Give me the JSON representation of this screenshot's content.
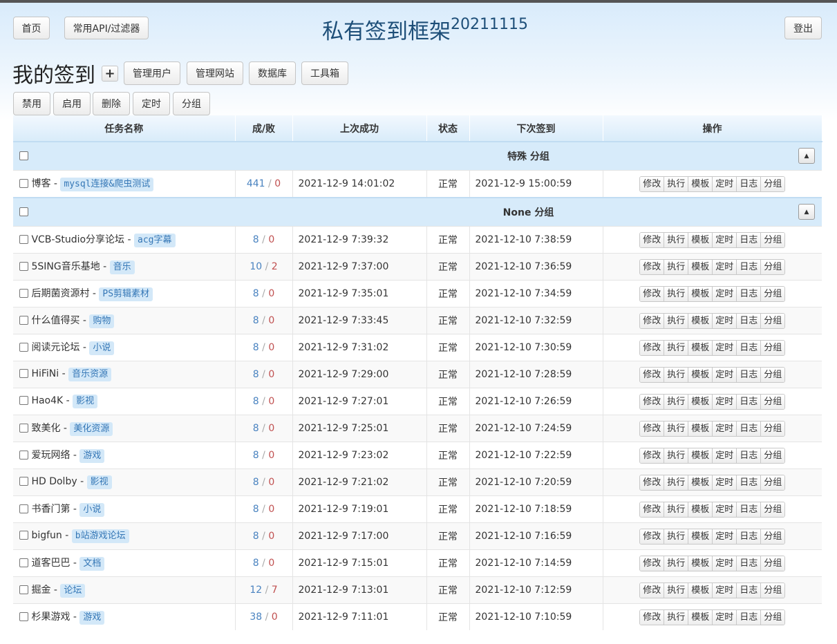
{
  "nav": {
    "home": "首页",
    "api_filter": "常用API/过滤器",
    "logout": "登出"
  },
  "app_title": "私有签到框架",
  "app_version": "20211115",
  "page_heading": "我的签到",
  "add_icon": "plus-icon",
  "toolbar_top": [
    "管理用户",
    "管理网站",
    "数据库",
    "工具箱"
  ],
  "toolbar_actions": [
    "禁用",
    "启用",
    "删除",
    "定时",
    "分组"
  ],
  "columns": [
    "任务名称",
    "成/败",
    "上次成功",
    "状态",
    "下次签到",
    "操作"
  ],
  "row_actions": [
    "修改",
    "执行",
    "模板",
    "定时",
    "日志",
    "分组"
  ],
  "groups": [
    {
      "title": "特殊 分组",
      "rows": [
        {
          "name": "博客",
          "tag": "mysql连接&爬虫测试",
          "success": "441",
          "fail": "0",
          "last": "2021-12-9 14:01:02",
          "status": "正常",
          "next": "2021-12-9 15:00:59"
        }
      ]
    },
    {
      "title": "None 分组",
      "rows": [
        {
          "name": "VCB-Studio分享论坛",
          "tag": "acg字幕",
          "success": "8",
          "fail": "0",
          "last": "2021-12-9 7:39:32",
          "status": "正常",
          "next": "2021-12-10 7:38:59"
        },
        {
          "name": "5SING音乐基地",
          "tag": "音乐",
          "success": "10",
          "fail": "2",
          "last": "2021-12-9 7:37:00",
          "status": "正常",
          "next": "2021-12-10 7:36:59"
        },
        {
          "name": "后期菌资源村",
          "tag": "PS剪辑素材",
          "success": "8",
          "fail": "0",
          "last": "2021-12-9 7:35:01",
          "status": "正常",
          "next": "2021-12-10 7:34:59"
        },
        {
          "name": "什么值得买",
          "tag": "购物",
          "success": "8",
          "fail": "0",
          "last": "2021-12-9 7:33:45",
          "status": "正常",
          "next": "2021-12-10 7:32:59"
        },
        {
          "name": "阅读元论坛",
          "tag": "小说",
          "success": "8",
          "fail": "0",
          "last": "2021-12-9 7:31:02",
          "status": "正常",
          "next": "2021-12-10 7:30:59"
        },
        {
          "name": "HiFiNi",
          "tag": "音乐资源",
          "success": "8",
          "fail": "0",
          "last": "2021-12-9 7:29:00",
          "status": "正常",
          "next": "2021-12-10 7:28:59"
        },
        {
          "name": "Hao4K",
          "tag": "影视",
          "success": "8",
          "fail": "0",
          "last": "2021-12-9 7:27:01",
          "status": "正常",
          "next": "2021-12-10 7:26:59"
        },
        {
          "name": "致美化",
          "tag": "美化资源",
          "success": "8",
          "fail": "0",
          "last": "2021-12-9 7:25:01",
          "status": "正常",
          "next": "2021-12-10 7:24:59"
        },
        {
          "name": "爱玩网络",
          "tag": "游戏",
          "success": "8",
          "fail": "0",
          "last": "2021-12-9 7:23:02",
          "status": "正常",
          "next": "2021-12-10 7:22:59"
        },
        {
          "name": "HD Dolby",
          "tag": "影视",
          "success": "8",
          "fail": "0",
          "last": "2021-12-9 7:21:02",
          "status": "正常",
          "next": "2021-12-10 7:20:59"
        },
        {
          "name": "书香门第",
          "tag": "小说",
          "success": "8",
          "fail": "0",
          "last": "2021-12-9 7:19:01",
          "status": "正常",
          "next": "2021-12-10 7:18:59"
        },
        {
          "name": "bigfun",
          "tag": "b站游戏论坛",
          "success": "8",
          "fail": "0",
          "last": "2021-12-9 7:17:00",
          "status": "正常",
          "next": "2021-12-10 7:16:59"
        },
        {
          "name": "道客巴巴",
          "tag": "文档",
          "success": "8",
          "fail": "0",
          "last": "2021-12-9 7:15:01",
          "status": "正常",
          "next": "2021-12-10 7:14:59"
        },
        {
          "name": "掘金",
          "tag": "论坛",
          "success": "12",
          "fail": "7",
          "last": "2021-12-9 7:13:01",
          "status": "正常",
          "next": "2021-12-10 7:12:59"
        },
        {
          "name": "杉果游戏",
          "tag": "游戏",
          "success": "38",
          "fail": "0",
          "last": "2021-12-9 7:11:01",
          "status": "正常",
          "next": "2021-12-10 7:10:59"
        }
      ]
    }
  ],
  "colors": {
    "accent_text": "#1d4e78",
    "tag_bg": "#d3e8f8",
    "tag_text": "#3577b6",
    "fail": "#c05050",
    "success": "#4a83c0"
  }
}
